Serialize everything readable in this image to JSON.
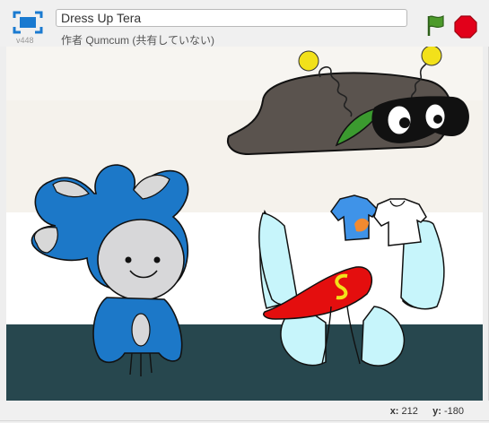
{
  "header": {
    "title_value": "Dress Up Tera",
    "version": "v448",
    "byline": "作者 Qumcum (共有していない)"
  },
  "icons": {
    "fullscreen": "fullscreen-icon",
    "green_flag": "green-flag-icon",
    "stop": "stop-icon"
  },
  "footer": {
    "x_label": "x:",
    "x_value": "212",
    "y_label": "y:",
    "y_value": "-180"
  },
  "colors": {
    "flag_green": "#4c9a2a",
    "stop_red": "#e2001a",
    "stage_floor": "#27474e",
    "tera_blue": "#1c78c8"
  }
}
